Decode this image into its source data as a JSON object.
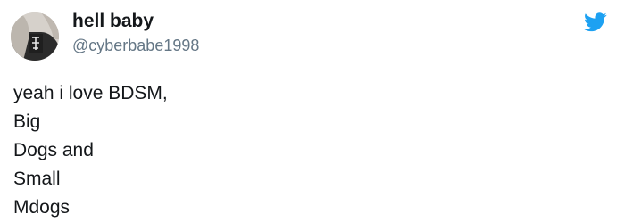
{
  "tweet": {
    "display_name": "hell baby",
    "handle": "@cyberbabe1998",
    "text_lines": [
      "yeah i love BDSM,",
      "Big",
      "Dogs and",
      "Small",
      "Mdogs"
    ]
  },
  "icons": {
    "avatar": "profile-photo",
    "brand": "twitter-bird-icon"
  },
  "colors": {
    "brand": "#1da1f2",
    "text": "#14171a",
    "handle": "#657786"
  }
}
